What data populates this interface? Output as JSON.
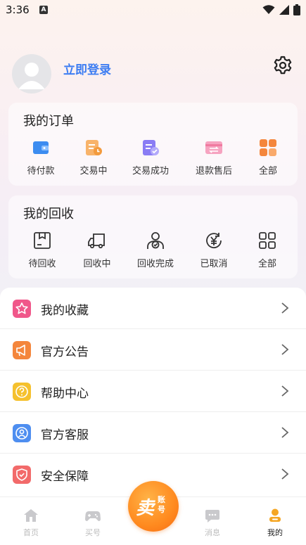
{
  "status_bar": {
    "time": "3:36",
    "notification_letter": "A"
  },
  "header": {
    "login_label": "立即登录"
  },
  "orders": {
    "title": "我的订单",
    "items": [
      {
        "label": "待付款",
        "icon": "wallet-icon",
        "color": "#3c8cf0"
      },
      {
        "label": "交易中",
        "icon": "clock-doc-icon",
        "color": "#f39a3c"
      },
      {
        "label": "交易成功",
        "icon": "check-doc-icon",
        "color": "#7a6cf2"
      },
      {
        "label": "退款售后",
        "icon": "refund-icon",
        "color": "#f07aa0"
      },
      {
        "label": "全部",
        "icon": "grid-icon",
        "color": "#f4863c"
      }
    ]
  },
  "recycle": {
    "title": "我的回收",
    "items": [
      {
        "label": "待回收",
        "icon": "box-icon"
      },
      {
        "label": "回收中",
        "icon": "truck-icon"
      },
      {
        "label": "回收完成",
        "icon": "user-check-icon"
      },
      {
        "label": "已取消",
        "icon": "yen-refresh-icon"
      },
      {
        "label": "全部",
        "icon": "grid-outline-icon"
      }
    ]
  },
  "menu": [
    {
      "label": "我的收藏",
      "icon": "star-icon",
      "color": "#f0578a"
    },
    {
      "label": "官方公告",
      "icon": "megaphone-icon",
      "color": "#f4863c"
    },
    {
      "label": "帮助中心",
      "icon": "question-icon",
      "color": "#f5c12e"
    },
    {
      "label": "官方客服",
      "icon": "service-icon",
      "color": "#4e8ef0"
    },
    {
      "label": "安全保障",
      "icon": "shield-icon",
      "color": "#f26a6a"
    }
  ],
  "tabs": [
    {
      "label": "首页",
      "icon": "home-icon"
    },
    {
      "label": "买号",
      "icon": "gamepad-icon"
    },
    {
      "label": "消息",
      "icon": "message-icon"
    },
    {
      "label": "我的",
      "icon": "profile-icon"
    }
  ],
  "sell_button": {
    "main": "卖",
    "sub": "账号"
  },
  "colors": {
    "accent": "#3d7df2",
    "active_tab": "#f5a623",
    "sell": "#ff8a1f"
  }
}
